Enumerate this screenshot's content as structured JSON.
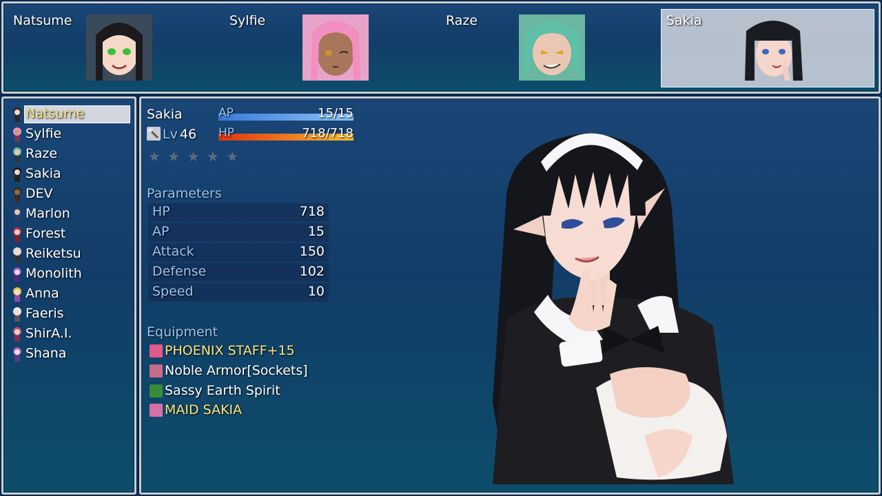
{
  "party": [
    {
      "name": "Natsume",
      "active": false,
      "hair": "#1b1b1e",
      "eyes": "#3bbf3b",
      "skin": "#f6d8c8"
    },
    {
      "name": "Sylfie",
      "active": false,
      "hair": "#f28ec0",
      "eyes": "#c9962c",
      "skin": "#a8765a"
    },
    {
      "name": "Raze",
      "active": false,
      "hair": "#5ec0a8",
      "eyes": "#e0a020",
      "skin": "#e9c7b2"
    },
    {
      "name": "Sakia",
      "active": true,
      "hair": "#1a1c24",
      "eyes": "#3a66c0",
      "skin": "#f4d6cc"
    }
  ],
  "character_list": [
    {
      "name": "Natsume",
      "selected": true,
      "color": "#2a2a2e"
    },
    {
      "name": "Sylfie",
      "selected": false,
      "color": "#f28ec0"
    },
    {
      "name": "Raze",
      "selected": false,
      "color": "#5ec0a8"
    },
    {
      "name": "Sakia",
      "selected": false,
      "color": "#1a1c24"
    },
    {
      "name": "DEV",
      "selected": false,
      "color": "#3a2a22"
    },
    {
      "name": "Marlon",
      "selected": false,
      "color": "#2c3e70"
    },
    {
      "name": "Forest",
      "selected": false,
      "color": "#c0304a"
    },
    {
      "name": "Reiketsu",
      "selected": false,
      "color": "#d8d8e0"
    },
    {
      "name": "Monolith",
      "selected": false,
      "color": "#8a50c8"
    },
    {
      "name": "Anna",
      "selected": false,
      "color": "#e8c040"
    },
    {
      "name": "Faeris",
      "selected": false,
      "color": "#e8e8f0"
    },
    {
      "name": "ShirA.I.",
      "selected": false,
      "color": "#d05070"
    },
    {
      "name": "Shana",
      "selected": false,
      "color": "#9a60d0"
    }
  ],
  "status": {
    "name": "Sakia",
    "level_label": "Lv",
    "level": "46",
    "ap_label": "AP",
    "ap_value": "15/15",
    "ap_ratio": 1.0,
    "hp_label": "HP",
    "hp_value": "718/718",
    "hp_ratio": 1.0,
    "stars_filled": 0,
    "stars_total": 5,
    "parameters_title": "Parameters",
    "parameters": [
      {
        "label": "HP",
        "value": "718"
      },
      {
        "label": "AP",
        "value": "15"
      },
      {
        "label": "Attack",
        "value": "150"
      },
      {
        "label": "Defense",
        "value": "102"
      },
      {
        "label": "Speed",
        "value": "10"
      }
    ],
    "equipment_title": "Equipment",
    "equipment": [
      {
        "name": "PHOENIX STAFF+15",
        "highlight": true,
        "icon_color": "#e05a8a"
      },
      {
        "name": "Noble Armor[Sockets]",
        "highlight": false,
        "icon_color": "#c86a8a"
      },
      {
        "name": "Sassy Earth Spirit",
        "highlight": false,
        "icon_color": "#3a8a3a"
      },
      {
        "name": "MAID SAKIA",
        "highlight": true,
        "icon_color": "#d870a8"
      }
    ]
  },
  "colors": {
    "highlight_text": "#ffe680",
    "system_text": "#9ac4ee",
    "ap_gauge": [
      "#3a7ad8",
      "#8ac4f8"
    ],
    "hp_gauge": [
      "#e03010",
      "#f8c030"
    ]
  }
}
